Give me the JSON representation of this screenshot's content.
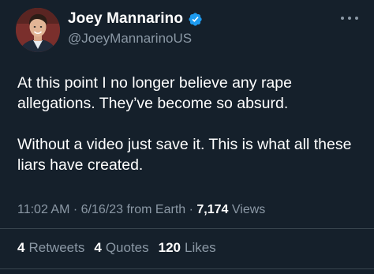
{
  "author": {
    "display_name": "Joey Mannarino",
    "handle": "@JoeyMannarinoUS",
    "verified_icon": "verified-badge-icon",
    "avatar": "avatar"
  },
  "tweet": {
    "paragraph_1": "At this point I no longer believe any rape allegations. They’ve become so absurd.",
    "paragraph_2": "Without a video just save it. This is what all these liars have created."
  },
  "meta": {
    "time": "11:02 AM",
    "sep1": " · ",
    "date": "6/16/23",
    "source": " from Earth",
    "sep2": " · ",
    "views_count": "7,174",
    "views_label": " Views"
  },
  "stats": {
    "retweets_count": "4",
    "retweets_label": "Retweets",
    "quotes_count": "4",
    "quotes_label": "Quotes",
    "likes_count": "120",
    "likes_label": "Likes"
  },
  "colors": {
    "background": "#15202b",
    "text": "#ffffff",
    "secondary": "#8b98a5",
    "verified": "#1d9bf0"
  }
}
